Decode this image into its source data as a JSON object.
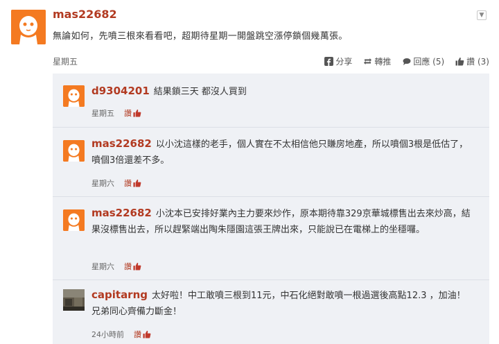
{
  "post": {
    "author": "mas22682",
    "text": "無論如何，先噴三根來看看吧，超期待星期一開盤跳空漲停鎖個幾萬張。",
    "time": "星期五",
    "menu_icon": "chevron-down-icon",
    "actions": {
      "share": "分享",
      "repost": "轉推",
      "reply": "回應 (5)",
      "like": "讚 (3)"
    }
  },
  "replies": [
    {
      "author": "d9304201",
      "text": "結果鎖三天 都沒人買到",
      "time": "星期五",
      "like": "讚"
    },
    {
      "author": "mas22682",
      "text": "以小沈這樣的老手，個人實在不太相信他只賺房地產，所以噴個3根是低估了，噴個3倍還差不多。",
      "time": "星期六",
      "like": "讚"
    },
    {
      "author": "mas22682",
      "text": "小沈本已安排好業內主力要來炒作，原本期待靠329京華城標售出去來炒高，結果沒標售出去，所以趕緊端出陶朱隱園這張王牌出來，只能說已在電梯上的坐穩囉。",
      "time": "星期六",
      "like": "讚"
    },
    {
      "author": "capitarng",
      "text": "太好啦！中工敢噴三根到11元，中石化絕對敢噴一根過選後高點12.3 ，加油！兄弟同心齊備力斷金！",
      "time": "24小時前",
      "like": "讚"
    }
  ],
  "colors": {
    "accent": "#b23a21",
    "avatar": "#f47a21",
    "panel": "#eff1f5"
  }
}
